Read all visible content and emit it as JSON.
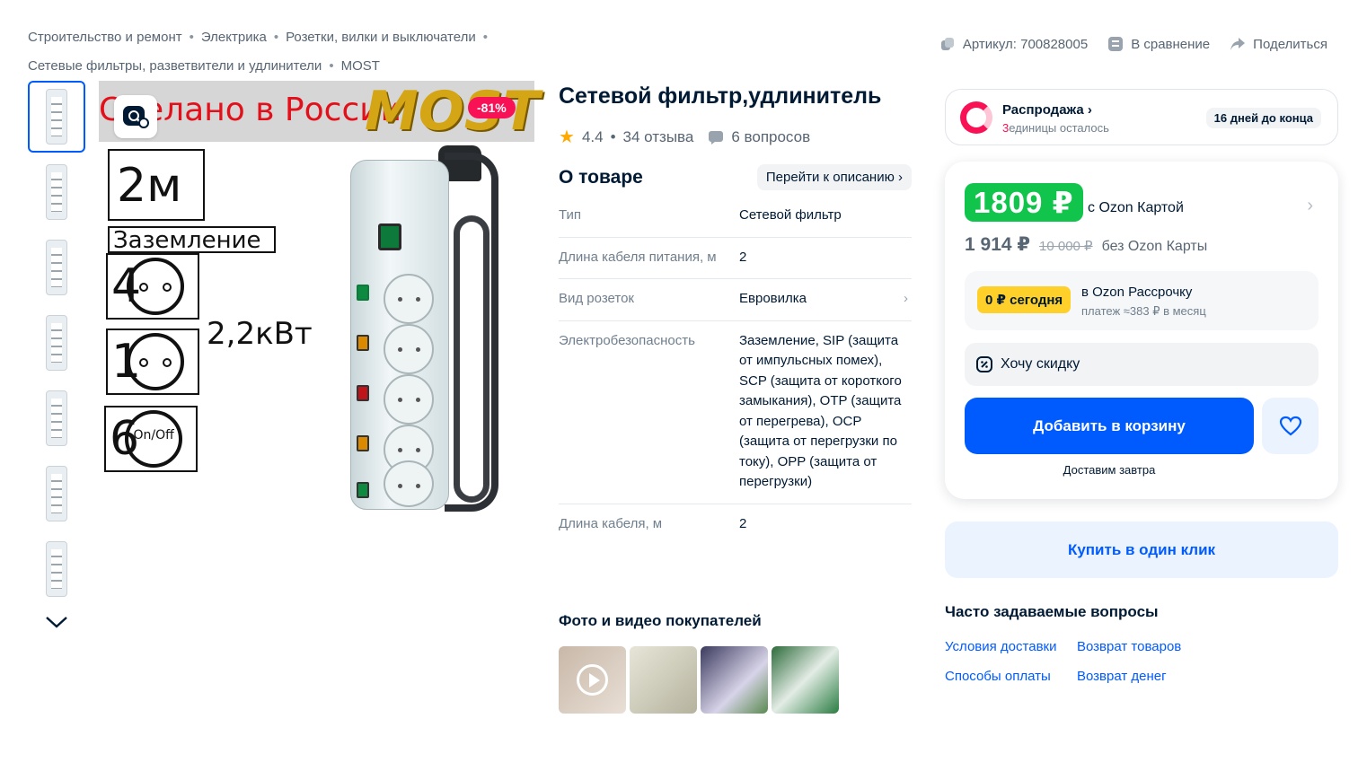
{
  "breadcrumbs": {
    "items": [
      "Строительство и ремонт",
      "Электрика",
      "Розетки, вилки и выключатели",
      "Сетевые фильтры, разветвители и удлинители",
      "MOST"
    ],
    "separator": "•"
  },
  "top_actions": {
    "article": "Артикул: 700828005",
    "compare": "В сравнение",
    "share": "Поделиться"
  },
  "gallery": {
    "banner_text": "Сделано в России",
    "brand_logo": "MOST",
    "discount": "-81%",
    "spec_length": "2м",
    "spec_ground": "Заземление",
    "spec_power": "2,2кВт",
    "spec_4": "4",
    "spec_1": "1",
    "spec_6": "6",
    "spec_onoff": "On/Off"
  },
  "product": {
    "title": "Сетевой фильтр,удлинитель",
    "rating": "4.4",
    "reviews": "34 отзыва",
    "questions": "6 вопросов",
    "dot": "•"
  },
  "about": {
    "heading": "О товаре",
    "goto_description": "Перейти к описанию ›",
    "specs": [
      {
        "k": "Тип",
        "v": "Сетевой фильтр"
      },
      {
        "k": "Длина кабеля питания, м",
        "v": "2"
      },
      {
        "k": "Вид розеток",
        "v": "Евровилка"
      },
      {
        "k": "Электробезопасность",
        "v": "Заземление, SIP (защита от импульсных помех), SCP (защита от короткого замыкания), OTP (защита от перегрева), OCP (защита от перегрузки по току), OPP (защита от перегрузки)"
      },
      {
        "k": "Длина кабеля, м",
        "v": "2"
      }
    ]
  },
  "ugc": {
    "title": "Фото и видео покупателей"
  },
  "sale": {
    "title": "Распродажа ›",
    "left_count": "3",
    "left_text": "единицы осталось",
    "days": "16 дней до конца"
  },
  "price": {
    "card_price": "1809 ₽",
    "card_label": "с Ozon Картой",
    "regular_price": "1 914 ₽",
    "old_price": "10 000 ₽",
    "regular_label": "без Ozon Карты",
    "install_badge": "0 ₽ сегодня",
    "install_title": "в Ozon Рассрочку",
    "install_sub": "платеж ≈383 ₽ в месяц",
    "want_discount": "Хочу скидку",
    "add_to_cart": "Добавить в корзину",
    "delivery": "Доставим завтра"
  },
  "one_click": "Купить в один клик",
  "faq": {
    "title": "Часто задаваемые вопросы",
    "links": [
      "Условия доставки",
      "Возврат товаров",
      "Способы оплаты",
      "Возврат денег"
    ]
  },
  "colors": {
    "accent": "#005bff",
    "price_green": "#10c44c",
    "sale_pink": "#f91155",
    "install_yellow": "#ffd02a"
  }
}
